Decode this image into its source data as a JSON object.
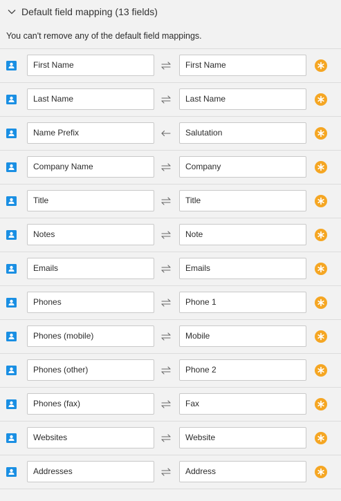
{
  "section": {
    "title": "Default field mapping (13 fields)",
    "note": "You can't remove any of the default field mappings."
  },
  "colors": {
    "contact_icon": "#1a8fe3",
    "star_badge": "#f5a623",
    "row_divider": "#dcdcdc",
    "background": "#f2f2f2"
  },
  "icons": {
    "section_toggle": "chevron-down-icon",
    "row_source": "contact-card-icon",
    "row_default": "star-badge-icon",
    "two_way": "two-way-sync-icon",
    "one_way": "one-way-arrow-left-icon"
  },
  "mappings": [
    {
      "left": "First Name",
      "right": "First Name",
      "direction": "two-way"
    },
    {
      "left": "Last Name",
      "right": "Last Name",
      "direction": "two-way"
    },
    {
      "left": "Name Prefix",
      "right": "Salutation",
      "direction": "one-way"
    },
    {
      "left": "Company Name",
      "right": "Company",
      "direction": "two-way"
    },
    {
      "left": "Title",
      "right": "Title",
      "direction": "two-way"
    },
    {
      "left": "Notes",
      "right": "Note",
      "direction": "two-way"
    },
    {
      "left": "Emails",
      "right": "Emails",
      "direction": "two-way"
    },
    {
      "left": "Phones",
      "right": "Phone 1",
      "direction": "two-way"
    },
    {
      "left": "Phones (mobile)",
      "right": "Mobile",
      "direction": "two-way"
    },
    {
      "left": "Phones (other)",
      "right": "Phone 2",
      "direction": "two-way"
    },
    {
      "left": "Phones (fax)",
      "right": "Fax",
      "direction": "two-way"
    },
    {
      "left": "Websites",
      "right": "Website",
      "direction": "two-way"
    },
    {
      "left": "Addresses",
      "right": "Address",
      "direction": "two-way"
    }
  ]
}
